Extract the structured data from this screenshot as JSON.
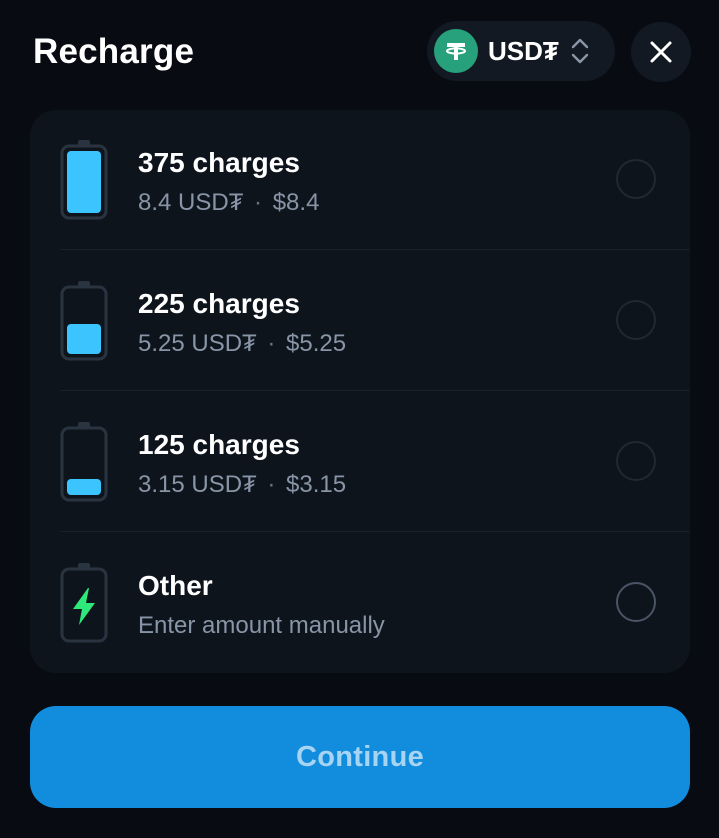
{
  "header": {
    "title": "Recharge",
    "currency": "USD₮",
    "currency_icon": "tether-icon",
    "close_icon": "close-icon"
  },
  "options": [
    {
      "title": "375 charges",
      "amount": "8.4 USD₮",
      "usd": "$8.4",
      "battery_level": 1.0,
      "selected": false
    },
    {
      "title": "225 charges",
      "amount": "5.25 USD₮",
      "usd": "$5.25",
      "battery_level": 0.6,
      "selected": false
    },
    {
      "title": "125 charges",
      "amount": "3.15 USD₮",
      "usd": "$3.15",
      "battery_level": 0.33,
      "selected": false
    },
    {
      "title": "Other",
      "subtitle": "Enter amount manually",
      "icon": "lightning-icon",
      "selected": false
    }
  ],
  "continue_label": "Continue",
  "colors": {
    "background": "#080c12",
    "card": "#0e141c",
    "accent_blue": "#128ddd",
    "battery_fill": "#3cc4ff",
    "tether_green": "#26a17b",
    "lightning_green": "#2ee87a",
    "secondary_text": "#8895a7"
  }
}
